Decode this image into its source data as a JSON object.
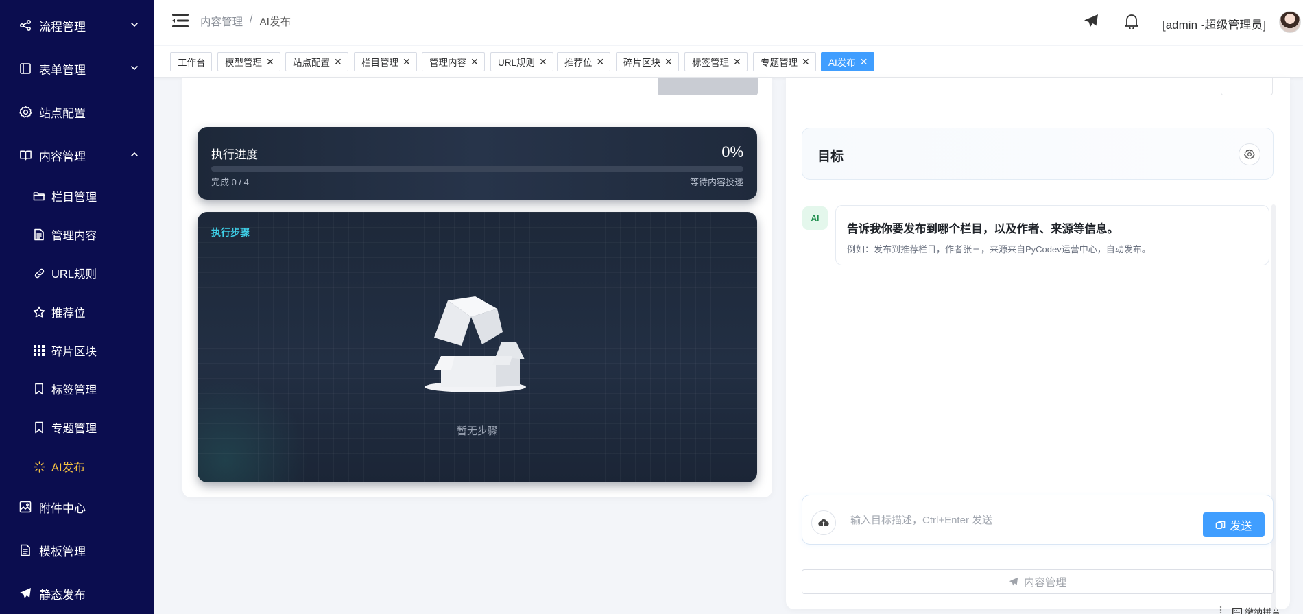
{
  "sidebar": {
    "items": [
      {
        "label": "流程管理",
        "icon": "share-icon",
        "arrow": "down"
      },
      {
        "label": "表单管理",
        "icon": "form-icon",
        "arrow": "down"
      },
      {
        "label": "站点配置",
        "icon": "gear-icon",
        "arrow": ""
      },
      {
        "label": "内容管理",
        "icon": "book-icon",
        "arrow": "up"
      },
      {
        "label": "附件中心",
        "icon": "image-icon",
        "arrow": ""
      },
      {
        "label": "模板管理",
        "icon": "document-icon",
        "arrow": ""
      },
      {
        "label": "静态发布",
        "icon": "paper-plane-icon",
        "arrow": ""
      }
    ],
    "subitems": [
      {
        "label": "栏目管理",
        "icon": "folder-icon"
      },
      {
        "label": "管理内容",
        "icon": "document-icon"
      },
      {
        "label": "URL规则",
        "icon": "link-icon"
      },
      {
        "label": "推荐位",
        "icon": "star-icon"
      },
      {
        "label": "碎片区块",
        "icon": "grid-icon"
      },
      {
        "label": "标签管理",
        "icon": "bookmark-icon"
      },
      {
        "label": "专题管理",
        "icon": "bookmark-icon"
      },
      {
        "label": "AI发布",
        "icon": "loading-icon",
        "active": true
      }
    ]
  },
  "header": {
    "breadcrumb": [
      "内容管理",
      "/",
      "AI发布"
    ],
    "user": "[admin -超级管理员]"
  },
  "tabs": [
    {
      "label": "工作台",
      "closable": false
    },
    {
      "label": "模型管理",
      "closable": true
    },
    {
      "label": "站点配置",
      "closable": true
    },
    {
      "label": "栏目管理",
      "closable": true
    },
    {
      "label": "管理内容",
      "closable": true
    },
    {
      "label": "URL规则",
      "closable": true
    },
    {
      "label": "推荐位",
      "closable": true
    },
    {
      "label": "碎片区块",
      "closable": true
    },
    {
      "label": "标签管理",
      "closable": true
    },
    {
      "label": "专题管理",
      "closable": true
    },
    {
      "label": "AI发布",
      "closable": true,
      "active": true
    }
  ],
  "progress": {
    "title": "执行进度",
    "percent_label": "0%",
    "percent": 0,
    "done_label": "完成 0 / 4",
    "status": "等待内容投递"
  },
  "steps": {
    "title": "执行步骤",
    "empty": "暂无步骤"
  },
  "goal": {
    "title": "目标"
  },
  "chat": {
    "avatar": "AI",
    "message": "告诉我你要发布到哪个栏目，以及作者、来源等信息。",
    "hint": "例如：发布到推荐栏目，作者张三，来源来自PyCodev运营中心，自动发布。"
  },
  "composer": {
    "placeholder": "输入目标描述，Ctrl+Enter 发送",
    "value": "",
    "send_label": "发送"
  },
  "content_button": {
    "label": "内容管理"
  },
  "corner": {
    "text": "缴纳拼音"
  },
  "colors": {
    "sidebar_bg": "#0b0d4f",
    "active_menu": "#f6c342",
    "primary": "#409eff",
    "panel_dark": "#1f2a3c"
  }
}
